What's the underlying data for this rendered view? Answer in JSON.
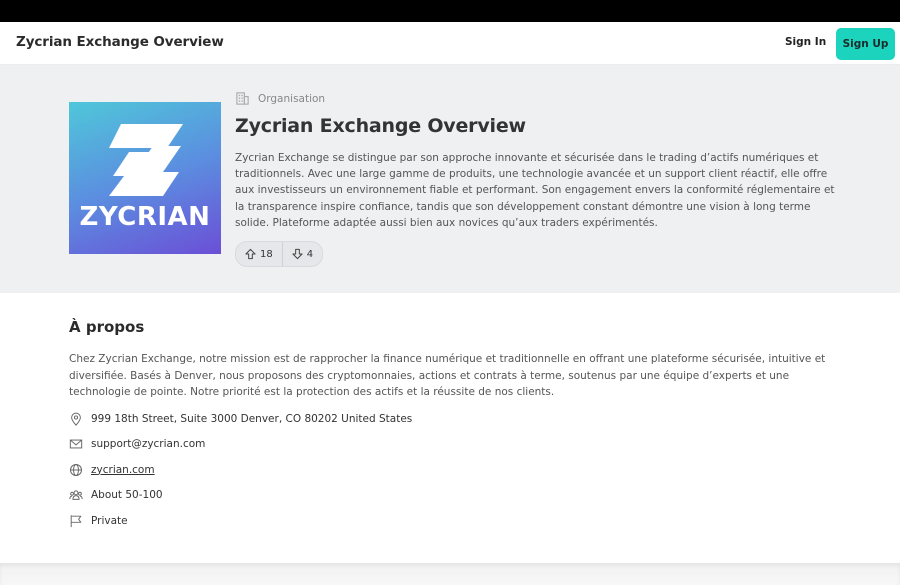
{
  "header": {
    "brand": "Zycrian Exchange Overview",
    "signin_label": "Sign In",
    "signup_label": "Sign Up"
  },
  "hero": {
    "logo_text": "ZYCRIAN",
    "org_label": "Organisation",
    "title": "Zycrian Exchange Overview",
    "description": "Zycrian Exchange se distingue par son approche innovante et sécurisée dans le trading d’actifs numériques et traditionnels. Avec une large gamme de produits, une technologie avancée et un support client réactif, elle offre aux investisseurs un environnement fiable et performant. Son engagement envers la conformité réglementaire et la transparence inspire confiance, tandis que son développement constant démontre une vision à long terme solide. Plateforme adaptée aussi bien aux novices qu’aux traders expérimentés.",
    "upvotes": "18",
    "downvotes": "4"
  },
  "about": {
    "title": "À propos",
    "text": "Chez Zycrian Exchange, notre mission est de rapprocher la finance numérique et traditionnelle en offrant une plateforme sécurisée, intuitive et diversifiée. Basés à Denver, nous proposons des cryptomonnaies, actions et contrats à terme, soutenus par une équipe d’experts et une technologie de pointe. Notre priorité est la protection des actifs et la réussite de nos clients.",
    "address": "999 18th Street, Suite 3000 Denver, CO 80202 United States",
    "email": "support@zycrian.com",
    "website": "zycrian.com",
    "size": "About 50-100",
    "type": "Private"
  },
  "colors": {
    "accent": "#1cd3be",
    "hero_bg": "#eff0f2",
    "logo_gradient_start": "#4fc7d9",
    "logo_gradient_end": "#6b4fd6"
  },
  "icons": [
    "building-icon",
    "arrow-up-icon",
    "arrow-down-icon",
    "location-pin-icon",
    "mail-icon",
    "globe-icon",
    "people-icon",
    "flag-icon"
  ]
}
